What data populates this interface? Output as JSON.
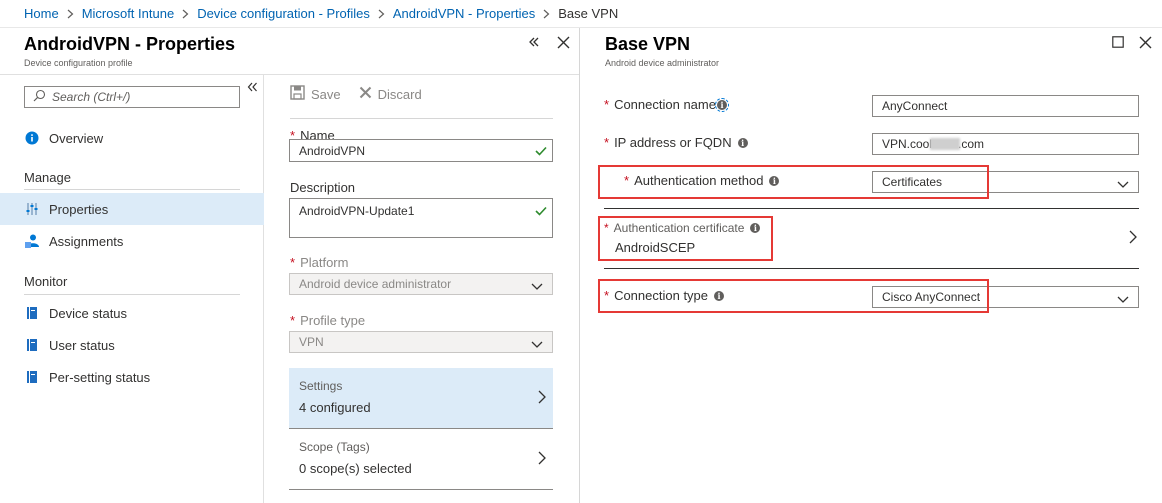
{
  "breadcrumb": {
    "items": [
      "Home",
      "Microsoft Intune",
      "Device configuration - Profiles",
      "AndroidVPN - Properties"
    ],
    "current": "Base VPN"
  },
  "left_blade": {
    "title": "AndroidVPN - Properties",
    "subtitle": "Device configuration profile"
  },
  "nav": {
    "search_placeholder": "Search (Ctrl+/)",
    "overview": "Overview",
    "manage_header": "Manage",
    "properties": "Properties",
    "assignments": "Assignments",
    "monitor_header": "Monitor",
    "device_status": "Device status",
    "user_status": "User status",
    "per_setting_status": "Per-setting status"
  },
  "toolbar": {
    "save": "Save",
    "discard": "Discard"
  },
  "form": {
    "name_label": "Name",
    "name_value": "AndroidVPN",
    "description_label": "Description",
    "description_value": "AndroidVPN-Update1",
    "platform_label": "Platform",
    "platform_value": "Android device administrator",
    "profile_type_label": "Profile type",
    "profile_type_value": "VPN",
    "settings_title": "Settings",
    "settings_value": "4 configured",
    "scope_title": "Scope (Tags)",
    "scope_value": "0 scope(s) selected"
  },
  "right_blade": {
    "title": "Base VPN",
    "subtitle": "Android device administrator",
    "connection_name_label": "Connection name",
    "connection_name_value": "AnyConnect",
    "ip_label": "IP address or FQDN",
    "ip_value_prefix": "VPN.cool",
    "ip_value_suffix": ".com",
    "auth_method_label": "Authentication method",
    "auth_method_value": "Certificates",
    "auth_cert_label": "Authentication certificate",
    "auth_cert_value": "AndroidSCEP",
    "conn_type_label": "Connection type",
    "conn_type_value": "Cisco AnyConnect"
  },
  "colors": {
    "link": "#0063b1",
    "selected_bg": "#dcebf8",
    "required": "#c50f1f",
    "highlight": "#e53935",
    "check": "#2e8b2e"
  },
  "icons": [
    "chevron-right-icon",
    "double-chevron-left-icon",
    "close-icon",
    "maximize-icon",
    "search-icon",
    "info-icon",
    "sliders-icon",
    "assignments-icon",
    "book-icon",
    "save-icon",
    "discard-icon",
    "check-icon",
    "chevron-down-icon"
  ]
}
